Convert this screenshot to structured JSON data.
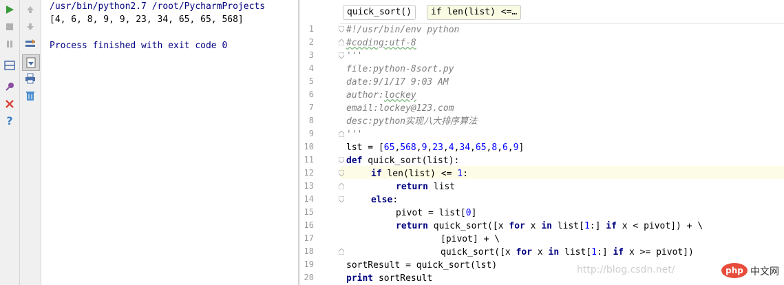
{
  "console": {
    "lines": [
      "/usr/bin/python2.7 /root/PycharmProjects",
      "[4, 6, 8, 9, 9, 23, 34, 65, 65, 568]",
      "",
      "Process finished with exit code 0"
    ],
    "colors": {
      "command": "#000080",
      "output": "#000000",
      "finished": "#000080"
    }
  },
  "toolbar": {
    "run": "run-icon",
    "up": "up-arrow-icon",
    "stop": "stop-icon",
    "down": "down-arrow-icon",
    "pause": "pause-icon",
    "rerun": "rerun-icon",
    "layout": "layout-icon",
    "scroll": "scroll-to-end-icon",
    "pin": "pin-icon",
    "print": "print-icon",
    "close": "close-icon",
    "trash": "trash-icon",
    "help": "help-icon"
  },
  "editor": {
    "breadcrumbs": [
      "quick_sort()",
      "if len(list) <=…"
    ],
    "line_numbers": [
      "1",
      "2",
      "3",
      "4",
      "5",
      "6",
      "7",
      "8",
      "9",
      "10",
      "11",
      "12",
      "13",
      "14",
      "15",
      "16",
      "17",
      "18",
      "19",
      "20"
    ],
    "current_line": "12",
    "lines": {
      "l1": "#!/usr/bin/env python",
      "l2": "#coding:utf-8",
      "l3": "'''",
      "l4": "file:python-8sort.py",
      "l5": "date:9/1/17 9:03 AM",
      "l6_a": "author:",
      "l6_b": "lockey",
      "l7": "email:lockey@123.com",
      "l8_a": "desc:python",
      "l8_b": "实现八大排序算法",
      "l9": "'''",
      "l10_a": "lst = [",
      "l10_nums": [
        "65",
        "568",
        "9",
        "23",
        "4",
        "34",
        "65",
        "8",
        "6",
        "9"
      ],
      "l10_c": "]",
      "l11_kw": "def",
      "l11_rest": " quick_sort(list):",
      "l12_kw": "if",
      "l12_a": " len(list) <= ",
      "l12_num": "1",
      "l12_b": ":",
      "l13_kw": "return",
      "l13_rest": " list",
      "l14_kw": "else",
      "l14_rest": ":",
      "l15_a": "pivot = list[",
      "l15_num": "0",
      "l15_b": "]",
      "l16_kw1": "return",
      "l16_a": " quick_sort([x ",
      "l16_kw2": "for",
      "l16_b": " x ",
      "l16_kw3": "in",
      "l16_c": " list[",
      "l16_num": "1",
      "l16_d": ":] ",
      "l16_kw4": "if",
      "l16_e": " x < pivot]) + \\",
      "l17": "[pivot] + \\",
      "l18_a": "quick_sort([x ",
      "l18_kw2": "for",
      "l18_b": " x ",
      "l18_kw3": "in",
      "l18_c": " list[",
      "l18_num": "1",
      "l18_d": ":] ",
      "l18_kw4": "if",
      "l18_e": " x >= pivot])",
      "l19": "sortResult = quick_sort(lst)",
      "l20_kw": "print",
      "l20_rest": " sortResult"
    }
  },
  "watermark": {
    "url": "http://blog.csdn.net/",
    "logo": "php",
    "site": "中文网"
  }
}
